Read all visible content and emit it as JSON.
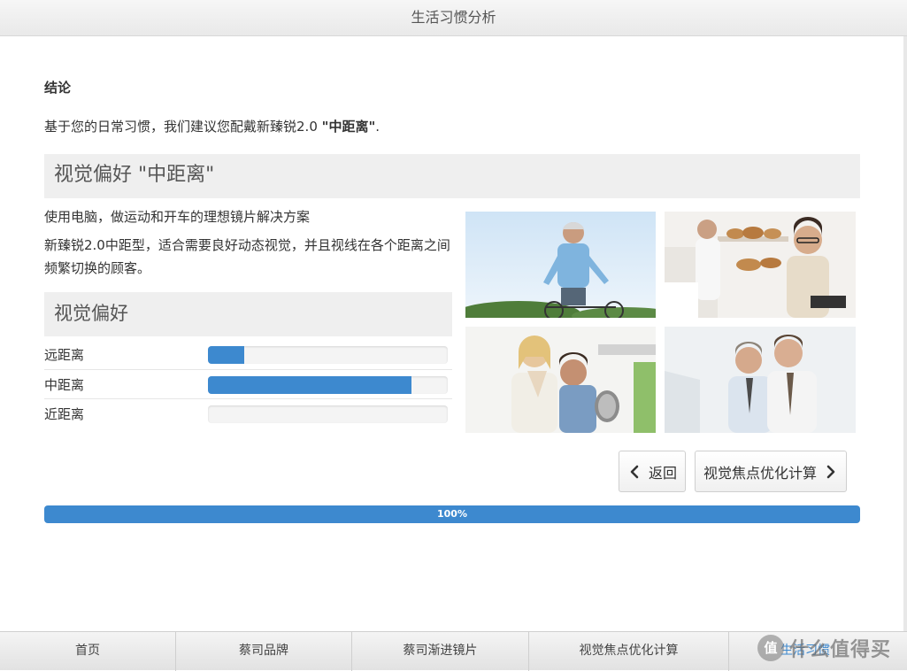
{
  "header": {
    "title": "生活习惯分析"
  },
  "conclusion": {
    "heading": "结论",
    "intro_prefix": "基于您的日常习惯，我们建议您配戴新臻锐2.0 ",
    "intro_bold": "\"中距离\"",
    "intro_suffix": "."
  },
  "recommendation": {
    "title": "视觉偏好 \"中距离\"",
    "desc1": "使用电脑，做运动和开车的理想镜片解决方案",
    "desc2": "新臻锐2.0中距型，适合需要良好动态视觉，并且视线在各个距离之间频繁切换的顾客。"
  },
  "preferences": {
    "title": "视觉偏好",
    "items": [
      {
        "label": "远距离",
        "value": 0.15
      },
      {
        "label": "中距离",
        "value": 0.85
      },
      {
        "label": "近距离",
        "value": 0.0
      }
    ]
  },
  "photos": [
    {
      "name": "cyclist-photo"
    },
    {
      "name": "bakery-photo"
    },
    {
      "name": "cooking-couple-photo"
    },
    {
      "name": "office-men-photo"
    }
  ],
  "buttons": {
    "back_label": "返回",
    "next_label": "视觉焦点优化计算",
    "back_icon": "chevron-left-icon",
    "next_icon": "chevron-right-icon"
  },
  "progress": {
    "label": "100%",
    "value": 1.0
  },
  "bottom_nav": {
    "items": [
      "首页",
      "蔡司品牌",
      "蔡司渐进镜片",
      "视觉焦点优化计算",
      "生活习惯"
    ]
  },
  "watermark": {
    "badge": "值",
    "text": "什么值得买"
  },
  "colors": {
    "accent": "#3d89cf",
    "panel": "#efefef"
  }
}
